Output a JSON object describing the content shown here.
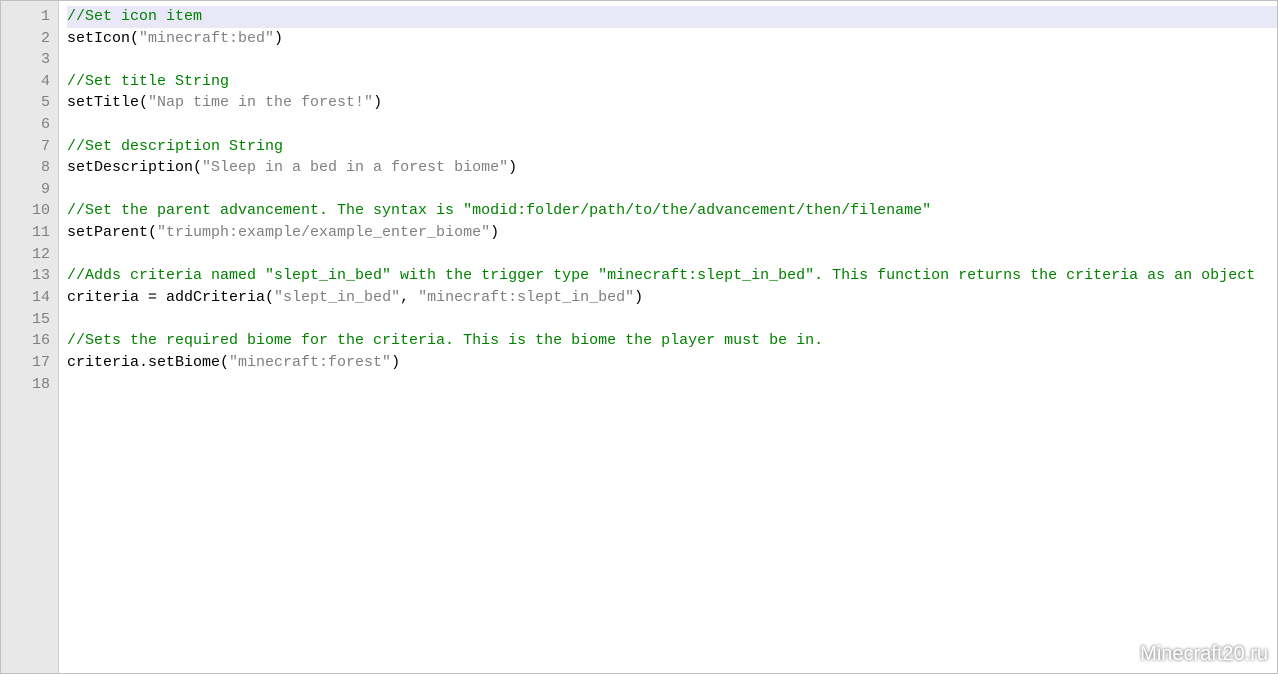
{
  "editor": {
    "lines": [
      {
        "n": 1,
        "type": "comment",
        "text": "//Set icon item",
        "current": true
      },
      {
        "n": 2,
        "type": "code",
        "prefix": "setIcon(",
        "str": "\"minecraft:bed\"",
        "suffix": ")"
      },
      {
        "n": 3,
        "type": "blank",
        "text": ""
      },
      {
        "n": 4,
        "type": "comment",
        "text": "//Set title String"
      },
      {
        "n": 5,
        "type": "code",
        "prefix": "setTitle(",
        "str": "\"Nap time in the forest!\"",
        "suffix": ")"
      },
      {
        "n": 6,
        "type": "blank",
        "text": ""
      },
      {
        "n": 7,
        "type": "comment",
        "text": "//Set description String"
      },
      {
        "n": 8,
        "type": "code",
        "prefix": "setDescription(",
        "str": "\"Sleep in a bed in a forest biome\"",
        "suffix": ")"
      },
      {
        "n": 9,
        "type": "blank",
        "text": ""
      },
      {
        "n": 10,
        "type": "comment",
        "text": "//Set the parent advancement. The syntax is \"modid:folder/path/to/the/advancement/then/filename\""
      },
      {
        "n": 11,
        "type": "code",
        "prefix": "setParent(",
        "str": "\"triumph:example/example_enter_biome\"",
        "suffix": ")"
      },
      {
        "n": 12,
        "type": "blank",
        "text": ""
      },
      {
        "n": 13,
        "type": "comment",
        "text": "//Adds criteria named \"slept_in_bed\" with the trigger type \"minecraft:slept_in_bed\". This function returns the criteria as an object"
      },
      {
        "n": 14,
        "type": "code2",
        "prefix": "criteria = addCriteria(",
        "str1": "\"slept_in_bed\"",
        "mid": ", ",
        "str2": "\"minecraft:slept_in_bed\"",
        "suffix": ")"
      },
      {
        "n": 15,
        "type": "blank",
        "text": ""
      },
      {
        "n": 16,
        "type": "comment",
        "text": "//Sets the required biome for the criteria. This is the biome the player must be in."
      },
      {
        "n": 17,
        "type": "code",
        "prefix": "criteria.setBiome(",
        "str": "\"minecraft:forest\"",
        "suffix": ")"
      },
      {
        "n": 18,
        "type": "blank",
        "text": ""
      }
    ]
  },
  "watermark": "Minecraft20.ru"
}
